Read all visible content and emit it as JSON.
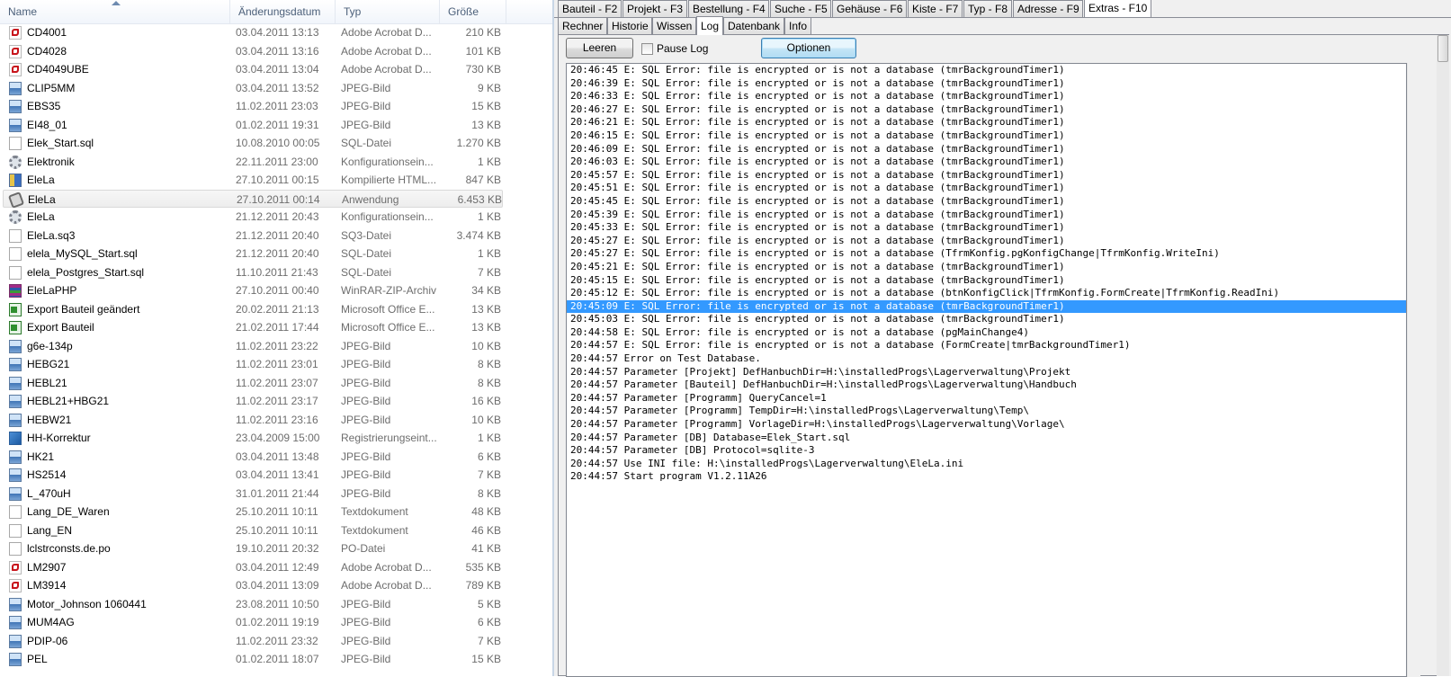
{
  "explorer": {
    "columns": {
      "name": "Name",
      "date": "Änderungsdatum",
      "type": "Typ",
      "size": "Größe"
    },
    "files": [
      {
        "name": "CD4001",
        "date": "03.04.2011 13:13",
        "type": "Adobe Acrobat D...",
        "size": "210 KB",
        "icon": "pdf"
      },
      {
        "name": "CD4028",
        "date": "03.04.2011 13:16",
        "type": "Adobe Acrobat D...",
        "size": "101 KB",
        "icon": "pdf"
      },
      {
        "name": "CD4049UBE",
        "date": "03.04.2011 13:04",
        "type": "Adobe Acrobat D...",
        "size": "730 KB",
        "icon": "pdf"
      },
      {
        "name": "CLIP5MM",
        "date": "03.04.2011 13:52",
        "type": "JPEG-Bild",
        "size": "9 KB",
        "icon": "jpg"
      },
      {
        "name": "EBS35",
        "date": "11.02.2011 23:03",
        "type": "JPEG-Bild",
        "size": "15 KB",
        "icon": "jpg"
      },
      {
        "name": "EI48_01",
        "date": "01.02.2011 19:31",
        "type": "JPEG-Bild",
        "size": "13 KB",
        "icon": "jpg"
      },
      {
        "name": "Elek_Start.sql",
        "date": "10.08.2010 00:05",
        "type": "SQL-Datei",
        "size": "1.270 KB",
        "icon": "sql"
      },
      {
        "name": "Elektronik",
        "date": "22.11.2011 23:00",
        "type": "Konfigurationsein...",
        "size": "1 KB",
        "icon": "cfg"
      },
      {
        "name": "EleLa",
        "date": "27.10.2011 00:15",
        "type": "Kompilierte HTML...",
        "size": "847 KB",
        "icon": "chm"
      },
      {
        "name": "EleLa",
        "date": "27.10.2011 00:14",
        "type": "Anwendung",
        "size": "6.453 KB",
        "icon": "app",
        "selected": true
      },
      {
        "name": "EleLa",
        "date": "21.12.2011 20:43",
        "type": "Konfigurationsein...",
        "size": "1 KB",
        "icon": "cfg"
      },
      {
        "name": "EleLa.sq3",
        "date": "21.12.2011 20:40",
        "type": "SQ3-Datei",
        "size": "3.474 KB",
        "icon": "sq3"
      },
      {
        "name": "elela_MySQL_Start.sql",
        "date": "21.12.2011 20:40",
        "type": "SQL-Datei",
        "size": "1 KB",
        "icon": "sql"
      },
      {
        "name": "elela_Postgres_Start.sql",
        "date": "11.10.2011 21:43",
        "type": "SQL-Datei",
        "size": "7 KB",
        "icon": "sql"
      },
      {
        "name": "EleLaPHP",
        "date": "27.10.2011 00:40",
        "type": "WinRAR-ZIP-Archiv",
        "size": "34 KB",
        "icon": "rar"
      },
      {
        "name": "Export Bauteil geändert",
        "date": "20.02.2011 21:13",
        "type": "Microsoft Office E...",
        "size": "13 KB",
        "icon": "xls"
      },
      {
        "name": "Export Bauteil",
        "date": "21.02.2011 17:44",
        "type": "Microsoft Office E...",
        "size": "13 KB",
        "icon": "xls"
      },
      {
        "name": "g6e-134p",
        "date": "11.02.2011 23:22",
        "type": "JPEG-Bild",
        "size": "10 KB",
        "icon": "jpg"
      },
      {
        "name": "HEBG21",
        "date": "11.02.2011 23:01",
        "type": "JPEG-Bild",
        "size": "8 KB",
        "icon": "jpg"
      },
      {
        "name": "HEBL21",
        "date": "11.02.2011 23:07",
        "type": "JPEG-Bild",
        "size": "8 KB",
        "icon": "jpg"
      },
      {
        "name": "HEBL21+HBG21",
        "date": "11.02.2011 23:17",
        "type": "JPEG-Bild",
        "size": "16 KB",
        "icon": "jpg"
      },
      {
        "name": "HEBW21",
        "date": "11.02.2011 23:16",
        "type": "JPEG-Bild",
        "size": "10 KB",
        "icon": "jpg"
      },
      {
        "name": "HH-Korrektur",
        "date": "23.04.2009 15:00",
        "type": "Registrierungseint...",
        "size": "1 KB",
        "icon": "reg"
      },
      {
        "name": "HK21",
        "date": "03.04.2011 13:48",
        "type": "JPEG-Bild",
        "size": "6 KB",
        "icon": "jpg"
      },
      {
        "name": "HS2514",
        "date": "03.04.2011 13:41",
        "type": "JPEG-Bild",
        "size": "7 KB",
        "icon": "jpg"
      },
      {
        "name": "L_470uH",
        "date": "31.01.2011 21:44",
        "type": "JPEG-Bild",
        "size": "8 KB",
        "icon": "jpg"
      },
      {
        "name": "Lang_DE_Waren",
        "date": "25.10.2011 10:11",
        "type": "Textdokument",
        "size": "48 KB",
        "icon": "txt"
      },
      {
        "name": "Lang_EN",
        "date": "25.10.2011 10:11",
        "type": "Textdokument",
        "size": "46 KB",
        "icon": "txt"
      },
      {
        "name": "lclstrconsts.de.po",
        "date": "19.10.2011 20:32",
        "type": "PO-Datei",
        "size": "41 KB",
        "icon": "txt"
      },
      {
        "name": "LM2907",
        "date": "03.04.2011 12:49",
        "type": "Adobe Acrobat D...",
        "size": "535 KB",
        "icon": "pdf"
      },
      {
        "name": "LM3914",
        "date": "03.04.2011 13:09",
        "type": "Adobe Acrobat D...",
        "size": "789 KB",
        "icon": "pdf"
      },
      {
        "name": "Motor_Johnson 1060441",
        "date": "23.08.2011 10:50",
        "type": "JPEG-Bild",
        "size": "5 KB",
        "icon": "jpg"
      },
      {
        "name": "MUM4AG",
        "date": "01.02.2011 19:19",
        "type": "JPEG-Bild",
        "size": "6 KB",
        "icon": "jpg"
      },
      {
        "name": "PDIP-06",
        "date": "11.02.2011 23:32",
        "type": "JPEG-Bild",
        "size": "7 KB",
        "icon": "jpg"
      },
      {
        "name": "PEL",
        "date": "01.02.2011 18:07",
        "type": "JPEG-Bild",
        "size": "15 KB",
        "icon": "jpg"
      }
    ]
  },
  "app": {
    "main_tabs": [
      {
        "label": "Bauteil - F2"
      },
      {
        "label": "Projekt - F3"
      },
      {
        "label": "Bestellung - F4"
      },
      {
        "label": "Suche - F5"
      },
      {
        "label": "Gehäuse - F6"
      },
      {
        "label": "Kiste - F7"
      },
      {
        "label": "Typ - F8"
      },
      {
        "label": "Adresse - F9"
      },
      {
        "label": "Extras - F10",
        "active": true
      }
    ],
    "sub_tabs": [
      {
        "label": "Rechner"
      },
      {
        "label": "Historie"
      },
      {
        "label": "Wissen"
      },
      {
        "label": "Log",
        "active": true
      },
      {
        "label": "Datenbank"
      },
      {
        "label": "Info"
      }
    ],
    "toolbar": {
      "leeren_label": "Leeren",
      "pause_label": "Pause Log",
      "pause_checked": false,
      "optionen_label": "Optionen"
    },
    "log": [
      "20:46:45 E: SQL Error: file is encrypted or is not a database (tmrBackgroundTimer1)",
      "20:46:39 E: SQL Error: file is encrypted or is not a database (tmrBackgroundTimer1)",
      "20:46:33 E: SQL Error: file is encrypted or is not a database (tmrBackgroundTimer1)",
      "20:46:27 E: SQL Error: file is encrypted or is not a database (tmrBackgroundTimer1)",
      "20:46:21 E: SQL Error: file is encrypted or is not a database (tmrBackgroundTimer1)",
      "20:46:15 E: SQL Error: file is encrypted or is not a database (tmrBackgroundTimer1)",
      "20:46:09 E: SQL Error: file is encrypted or is not a database (tmrBackgroundTimer1)",
      "20:46:03 E: SQL Error: file is encrypted or is not a database (tmrBackgroundTimer1)",
      "20:45:57 E: SQL Error: file is encrypted or is not a database (tmrBackgroundTimer1)",
      "20:45:51 E: SQL Error: file is encrypted or is not a database (tmrBackgroundTimer1)",
      "20:45:45 E: SQL Error: file is encrypted or is not a database (tmrBackgroundTimer1)",
      "20:45:39 E: SQL Error: file is encrypted or is not a database (tmrBackgroundTimer1)",
      "20:45:33 E: SQL Error: file is encrypted or is not a database (tmrBackgroundTimer1)",
      "20:45:27 E: SQL Error: file is encrypted or is not a database (tmrBackgroundTimer1)",
      "20:45:27 E: SQL Error: file is encrypted or is not a database (TfrmKonfig.pgKonfigChange|TfrmKonfig.WriteIni)",
      "20:45:21 E: SQL Error: file is encrypted or is not a database (tmrBackgroundTimer1)",
      "20:45:15 E: SQL Error: file is encrypted or is not a database (tmrBackgroundTimer1)",
      "20:45:12 E: SQL Error: file is encrypted or is not a database (btnKonfigClick|TfrmKonfig.FormCreate|TfrmKonfig.ReadIni)",
      "20:45:09 E: SQL Error: file is encrypted or is not a database (tmrBackgroundTimer1)",
      "20:45:03 E: SQL Error: file is encrypted or is not a database (tmrBackgroundTimer1)",
      "20:44:58 E: SQL Error: file is encrypted or is not a database (pgMainChange4)",
      "20:44:57 E: SQL Error: file is encrypted or is not a database (FormCreate|tmrBackgroundTimer1)",
      "20:44:57 Error on Test Database.",
      "20:44:57 Parameter [Projekt] DefHanbuchDir=H:\\installedProgs\\Lagerverwaltung\\Projekt",
      "20:44:57 Parameter [Bauteil] DefHanbuchDir=H:\\installedProgs\\Lagerverwaltung\\Handbuch",
      "20:44:57 Parameter [Programm] QueryCancel=1",
      "20:44:57 Parameter [Programm] TempDir=H:\\installedProgs\\Lagerverwaltung\\Temp\\",
      "20:44:57 Parameter [Programm] VorlageDir=H:\\installedProgs\\Lagerverwaltung\\Vorlage\\",
      "20:44:57 Parameter [DB] Database=Elek_Start.sql",
      "20:44:57 Parameter [DB] Protocol=sqlite-3",
      "20:44:57 Use INI file: H:\\installedProgs\\Lagerverwaltung\\EleLa.ini",
      "20:44:57 Start program V1.2.11A26"
    ],
    "log_selected_index": 18,
    "colors": {
      "selection": "#3399ff",
      "pdf_red": "#c8141c",
      "header_text": "#4c607a"
    }
  }
}
